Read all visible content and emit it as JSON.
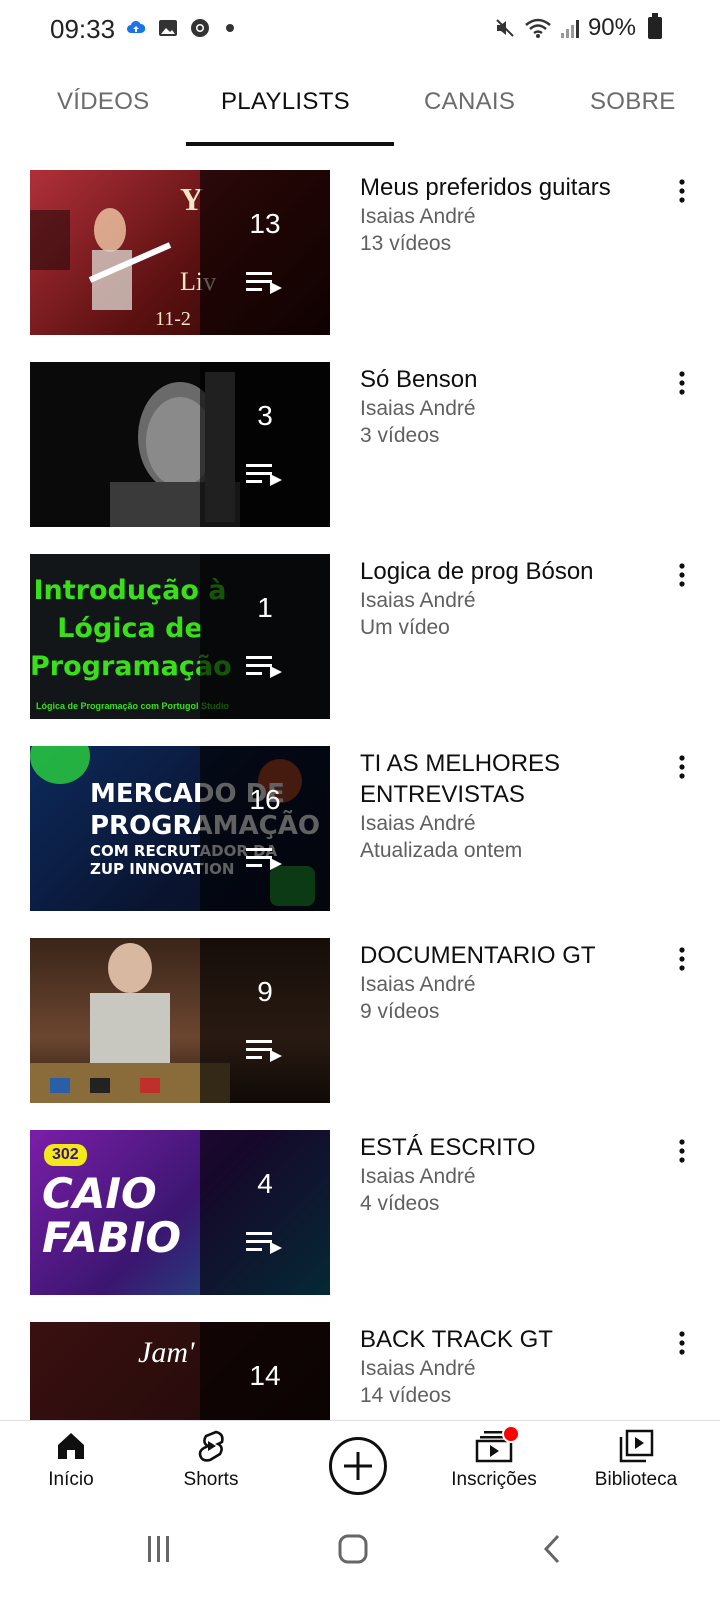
{
  "status_bar": {
    "time": "09:33",
    "battery": "90%"
  },
  "tabs": [
    {
      "label": "VÍDEOS",
      "active": false
    },
    {
      "label": "PLAYLISTS",
      "active": true
    },
    {
      "label": "CANAIS",
      "active": false
    },
    {
      "label": "SOBRE",
      "active": false
    }
  ],
  "playlists": [
    {
      "title": "Meus preferidos guitars",
      "owner": "Isaias André",
      "meta": "13 vídeos",
      "count": "13",
      "thumb_color": "#7a1f1f"
    },
    {
      "title": "Só Benson",
      "owner": "Isaias André",
      "meta": "3 vídeos",
      "count": "3",
      "thumb_color": "#1a1a1a"
    },
    {
      "title": "Logica  de prog Bóson",
      "owner": "Isaias André",
      "meta": "Um vídeo",
      "count": "1",
      "thumb_color": "#101418",
      "thumb_text_lines": [
        "Introdução à",
        "Lógica de",
        "Programação"
      ],
      "thumb_caption": "Lógica de Programação com Portugol Studio"
    },
    {
      "title": "TI AS MELHORES ENTREVISTAS",
      "owner": "Isaias André",
      "meta": "Atualizada ontem",
      "count": "16",
      "thumb_color": "#0c1d3f",
      "thumb_text_lines": [
        "MERCADO DE",
        "PROGRAMAÇÃO",
        "COM RECRUTADOR DA",
        "ZUP INNOVATION"
      ]
    },
    {
      "title": "DOCUMENTARIO GT",
      "owner": "Isaias André",
      "meta": "9 vídeos",
      "count": "9",
      "thumb_color": "#5b3a24"
    },
    {
      "title": "ESTÁ ESCRITO",
      "owner": "Isaias André",
      "meta": "4 vídeos",
      "count": "4",
      "thumb_color": "#3b1670",
      "thumb_text_lines": [
        "302",
        "CAIO",
        "FABIO"
      ]
    },
    {
      "title": "BACK TRACK GT",
      "owner": "Isaias André",
      "meta": "14 vídeos",
      "count": "14",
      "thumb_color": "#2a0d0d",
      "thumb_text_lines": [
        "Jam'"
      ]
    }
  ],
  "bottom_nav": [
    {
      "label": "Início",
      "icon": "home-icon"
    },
    {
      "label": "Shorts",
      "icon": "shorts-icon"
    },
    {
      "label": "",
      "icon": "create-icon"
    },
    {
      "label": "Inscrições",
      "icon": "subscriptions-icon"
    },
    {
      "label": "Biblioteca",
      "icon": "library-icon"
    }
  ],
  "colors": {
    "text_primary": "#0f0f0f",
    "text_secondary": "#606060",
    "notification": "#ff0000"
  }
}
